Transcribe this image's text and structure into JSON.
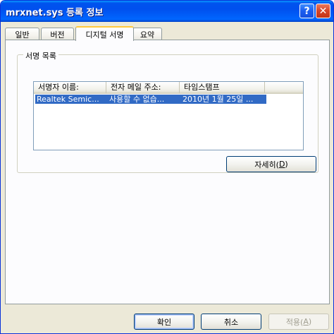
{
  "window": {
    "title": "mrxnet.sys 등록 정보",
    "help_glyph": "?",
    "close_glyph": "✕"
  },
  "tabs": [
    {
      "label": "일반",
      "active": false
    },
    {
      "label": "버전",
      "active": false
    },
    {
      "label": "디지털 서명",
      "active": true
    },
    {
      "label": "요약",
      "active": false
    }
  ],
  "signatures": {
    "group_label": "서명 목록",
    "columns": [
      "서명자 이름:",
      "전자 메일 주소:",
      "타임스탬프"
    ],
    "rows": [
      [
        "Realtek Semic...",
        "사용할 수 없습...",
        "2010년 1월 25일 ..."
      ]
    ],
    "selected_row": 0,
    "detail_button": "자세히(D)",
    "detail_button_prefix": "자세히(",
    "detail_button_mnemonic": "D",
    "detail_button_suffix": ")"
  },
  "footer": {
    "ok_label": "확인",
    "cancel_label": "취소",
    "apply_prefix": "적용(",
    "apply_mnemonic": "A",
    "apply_suffix": ")"
  },
  "colors": {
    "titlebar": "#0054e3",
    "selection": "#316ac5",
    "dialog_bg": "#ece9d8",
    "tab_accent": "#ffc83c"
  }
}
